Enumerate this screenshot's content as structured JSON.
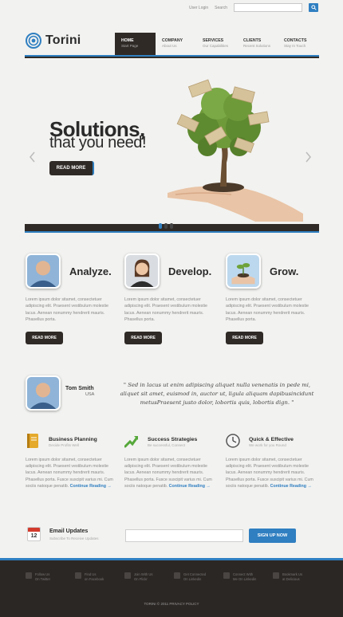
{
  "topbar": {
    "user_login": "User Login",
    "search_label": "Search",
    "search_placeholder": ""
  },
  "brand": {
    "name": "Torini"
  },
  "nav": [
    {
      "title": "Home",
      "sub": "Start Page",
      "active": true
    },
    {
      "title": "Company",
      "sub": "About Us"
    },
    {
      "title": "Services",
      "sub": "Our Capabilities"
    },
    {
      "title": "Clients",
      "sub": "Recent Solutions"
    },
    {
      "title": "Contacts",
      "sub": "Stay In Touch"
    }
  ],
  "hero": {
    "title": "Solutions,",
    "subtitle": "that you need!",
    "button": "READ MORE",
    "slides": 3,
    "active_slide": 0
  },
  "features": [
    {
      "title": "Analyze.",
      "text": "Lorem ipsum dolor sitamet, consectetuer adipiscing elit. Praesent vestibulum molestie lacus. Aenean nonummy hendrerit mauris. Phasellus porta.",
      "button": "READ MORE"
    },
    {
      "title": "Develop.",
      "text": "Lorem ipsum dolor sitamet, consectetuer adipiscing elit. Praesent vestibulum molestie lacus. Aenean nonummy hendrerit mauris. Phasellus porta.",
      "button": "READ MORE"
    },
    {
      "title": "Grow.",
      "text": "Lorem ipsum dolor sitamet, consectetuer adipiscing elit. Praesent vestibulum molestie lacus. Aenean nonummy hendrerit mauris. Phasellus porta.",
      "button": "READ MORE"
    }
  ],
  "testimonial": {
    "name": "Tom Smith",
    "location": "USA",
    "quote": "\" Sed in lacus ut enim adipiscing aliquet nulla venenatis in pede mi, aliquet sit amet, euismod in, auctor ut, ligula aliquam dapibusincidunt metusPraesent justo dolor, lobortis quis, lobortis dign. \""
  },
  "secondary": [
    {
      "title": "Business Planning",
      "sub": "Decide Profits Well",
      "text": "Lorem ipsum dolor sitamet, consectetuer adipiscing elit. Praesent vestibulum molestie lacus. Aenean nonummy hendrerit mauris. Phasellus porta. Fusce suscipit varius mi. Cum sociis natoque penatib.",
      "more": "Continue Reading",
      "icon": "notebook-icon"
    },
    {
      "title": "Success Strategies",
      "sub": "Be successful, Connect",
      "text": "Lorem ipsum dolor sitamet, consectetuer adipiscing elit. Praesent vestibulum molestie lacus. Aenean nonummy hendrerit mauris. Phasellus porta. Fusce suscipit varius mi. Cum sociis natoque penatib.",
      "more": "Continue Reading",
      "icon": "growth-arrow-icon"
    },
    {
      "title": "Quick & Effective",
      "sub": "We work for you Round",
      "text": "Lorem ipsum dolor sitamet, consectetuer adipiscing elit. Praesent vestibulum molestie lacus. Aenean nonummy hendrerit mauris. Phasellus porta. Fusce suscipit varius mi. Cum sociis natoque penatib.",
      "more": "Continue Reading",
      "icon": "clock-icon"
    }
  ],
  "email": {
    "title": "Email Updates",
    "sub": "Subscribe To Receive Updates",
    "day": "12",
    "placeholder": "",
    "button": "SIGN UP NOW"
  },
  "social": [
    {
      "l1": "Follow Us",
      "l2": "On Twitter"
    },
    {
      "l1": "Find Us",
      "l2": "on Facebook"
    },
    {
      "l1": "Join With Us",
      "l2": "On Flickr"
    },
    {
      "l1": "Get Connected",
      "l2": "On Linkedin"
    },
    {
      "l1": "Connect With",
      "l2": "Me On Linkedin"
    },
    {
      "l1": "Bookmark Us",
      "l2": "at Delicious"
    }
  ],
  "copyright": "TORINI © 2011 PRIVACY POLICY",
  "colors": {
    "accent": "#2f7fc1",
    "dark": "#2f2a26",
    "background": "#f2f2f0"
  }
}
